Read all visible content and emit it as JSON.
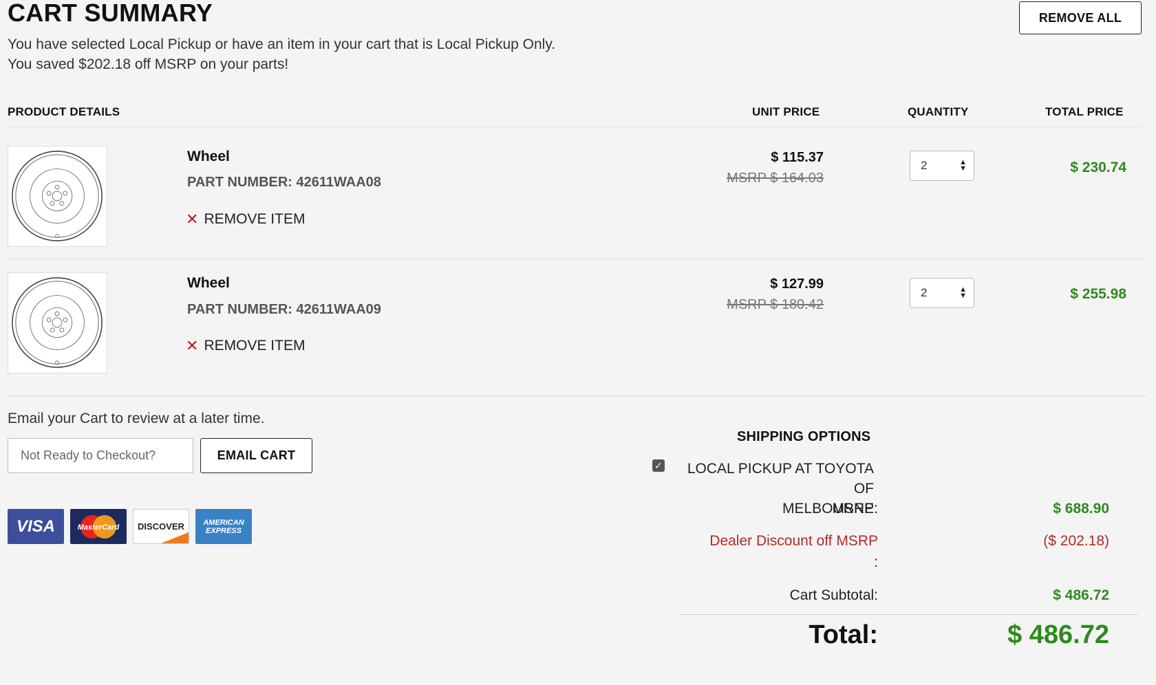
{
  "header": {
    "title": "CART SUMMARY",
    "notice_line1": "You have selected Local Pickup or have an item in your cart that is Local Pickup Only.",
    "notice_line2": "You saved $202.18 off MSRP on your parts!",
    "remove_all_label": "REMOVE ALL"
  },
  "columns": {
    "product": "PRODUCT DETAILS",
    "unit_price": "UNIT PRICE",
    "quantity": "QUANTITY",
    "total_price": "TOTAL PRICE"
  },
  "items": [
    {
      "name": "Wheel",
      "part_number": "PART NUMBER: 42611WAA08",
      "remove_label": "REMOVE ITEM",
      "unit_price": "$ 115.37",
      "msrp": "MSRP $ 164.03",
      "quantity": "2",
      "total": "$ 230.74"
    },
    {
      "name": "Wheel",
      "part_number": "PART NUMBER: 42611WAA09",
      "remove_label": "REMOVE ITEM",
      "unit_price": "$ 127.99",
      "msrp": "MSRP $ 180.42",
      "quantity": "2",
      "total": "$ 255.98"
    }
  ],
  "email": {
    "prompt": "Email your Cart to review at a later time.",
    "placeholder": "Not Ready to Checkout?",
    "button_label": "EMAIL CART"
  },
  "payment_cards": [
    {
      "label": "VISA",
      "icon": "visa-icon"
    },
    {
      "label": "MasterCard",
      "icon": "mastercard-icon"
    },
    {
      "label": "DISCOVER",
      "icon": "discover-icon"
    },
    {
      "label": "AMERICAN EXPRESS",
      "icon": "amex-icon"
    }
  ],
  "shipping": {
    "heading": "SHIPPING OPTIONS",
    "option_line1": "LOCAL PICKUP AT TOYOTA OF",
    "option_line2": "MELBOURNE",
    "option_checked": true
  },
  "summary": {
    "msrp_label": "MSRP:",
    "msrp_value": "$ 688.90",
    "discount_label": "Dealer Discount off MSRP",
    "discount_colon": ":",
    "discount_value": "($ 202.18)",
    "subtotal_label": "Cart Subtotal:",
    "subtotal_value": "$ 486.72",
    "total_label": "Total:",
    "total_value": "$ 486.72"
  },
  "colors": {
    "price_green": "#2e8a1f",
    "discount_red": "#b22a2a",
    "remove_x_red": "#c0151c",
    "background": "#f4f4f4"
  }
}
